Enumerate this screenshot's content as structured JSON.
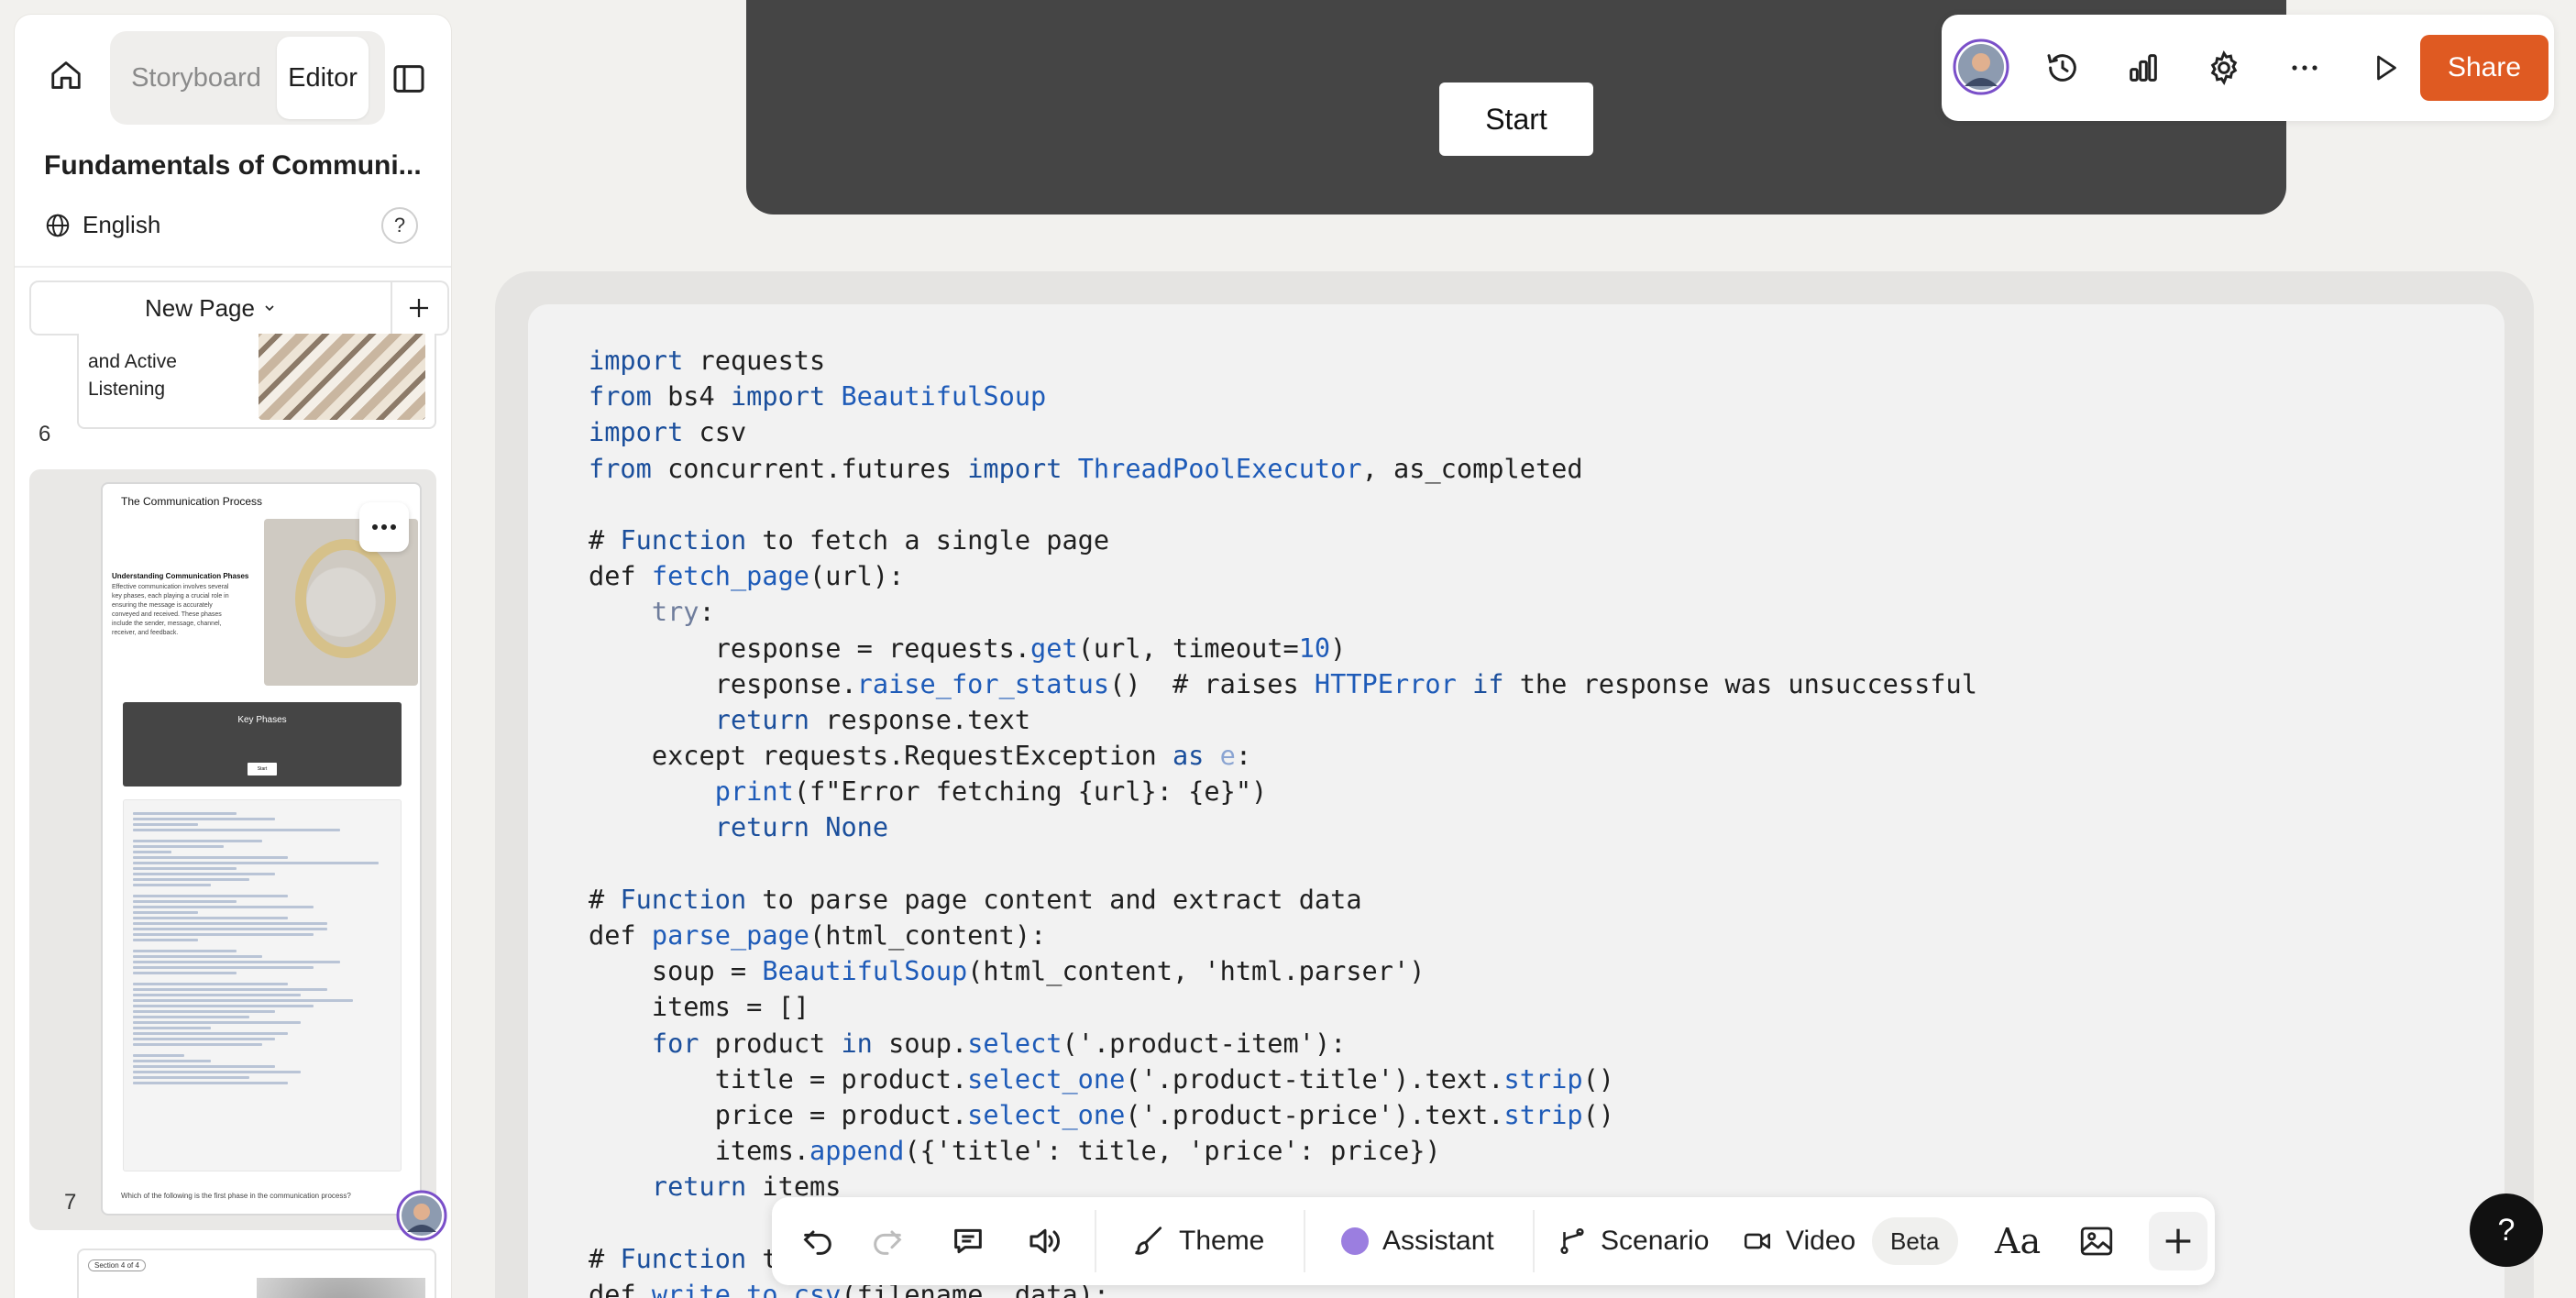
{
  "sidebar": {
    "tabs": {
      "storyboard": "Storyboard",
      "editor": "Editor"
    },
    "course_title": "Fundamentals of Communi...",
    "language": "English",
    "help": "?",
    "new_page": "New Page",
    "pages": [
      {
        "number": "6",
        "title": "and Active\nListening"
      },
      {
        "number": "7",
        "title": "The Communication Process",
        "subtitle": "Understanding Communication Phases",
        "body": "Effective communication involves several key phases, each playing a crucial role in ensuring the message is accurately conveyed and received. These phases include the sender, message, channel, receiver, and feedback.",
        "block_title": "Key Phases",
        "block_button": "Start",
        "question": "Which of the following is the first phase in the communication process?"
      },
      {
        "badge": "Section 4 of 4"
      }
    ]
  },
  "hero": {
    "button": "Start"
  },
  "code_lines": [
    [
      [
        "kw",
        "import"
      ],
      [
        "t",
        " requests"
      ]
    ],
    [
      [
        "kw",
        "from"
      ],
      [
        "t",
        " bs4 "
      ],
      [
        "kw",
        "import"
      ],
      [
        "fn",
        " BeautifulSoup"
      ]
    ],
    [
      [
        "kw",
        "import"
      ],
      [
        "t",
        " csv"
      ]
    ],
    [
      [
        "kw",
        "from"
      ],
      [
        "t",
        " concurrent.futures "
      ],
      [
        "kw",
        "import"
      ],
      [
        "fn",
        " ThreadPoolExecutor"
      ],
      [
        "t",
        ", as_completed"
      ]
    ],
    [],
    [
      [
        "t",
        "# "
      ],
      [
        "kw",
        "Function"
      ],
      [
        "t",
        " to fetch a single page"
      ]
    ],
    [
      [
        "t",
        "def "
      ],
      [
        "fn",
        "fetch_page"
      ],
      [
        "t",
        "(url):"
      ]
    ],
    [
      [
        "t",
        "    "
      ],
      [
        "try",
        "try"
      ],
      [
        "t",
        ":"
      ]
    ],
    [
      [
        "t",
        "        response = requests."
      ],
      [
        "fn",
        "get"
      ],
      [
        "t",
        "(url, timeout="
      ],
      [
        "num",
        "10"
      ],
      [
        "t",
        ")"
      ]
    ],
    [
      [
        "t",
        "        response."
      ],
      [
        "fn",
        "raise_for_status"
      ],
      [
        "t",
        "()  # raises "
      ],
      [
        "fn",
        "HTTPError"
      ],
      [
        "t",
        " "
      ],
      [
        "kw",
        "if"
      ],
      [
        "t",
        " the response was unsuccessful"
      ]
    ],
    [
      [
        "t",
        "        "
      ],
      [
        "kw",
        "return"
      ],
      [
        "t",
        " response.text"
      ]
    ],
    [
      [
        "t",
        "    except requests.RequestException "
      ],
      [
        "kw",
        "as"
      ],
      [
        "t",
        " "
      ],
      [
        "ev",
        "e"
      ],
      [
        "t",
        ":"
      ]
    ],
    [
      [
        "t",
        "        "
      ],
      [
        "fn",
        "print"
      ],
      [
        "t",
        "(f\"Error fetching {url}: {e}\")"
      ]
    ],
    [
      [
        "t",
        "        "
      ],
      [
        "kw",
        "return"
      ],
      [
        "t",
        " "
      ],
      [
        "kw",
        "None"
      ]
    ],
    [],
    [
      [
        "t",
        "# "
      ],
      [
        "kw",
        "Function"
      ],
      [
        "t",
        " to parse page content and extract data"
      ]
    ],
    [
      [
        "t",
        "def "
      ],
      [
        "fn",
        "parse_page"
      ],
      [
        "t",
        "(html_content):"
      ]
    ],
    [
      [
        "t",
        "    soup = "
      ],
      [
        "fn",
        "BeautifulSoup"
      ],
      [
        "t",
        "(html_content, 'html.parser')"
      ]
    ],
    [
      [
        "t",
        "    items = []"
      ]
    ],
    [
      [
        "t",
        "    "
      ],
      [
        "kw",
        "for"
      ],
      [
        "t",
        " product "
      ],
      [
        "kw",
        "in"
      ],
      [
        "t",
        " soup."
      ],
      [
        "fn",
        "select"
      ],
      [
        "t",
        "('.product-item'):"
      ]
    ],
    [
      [
        "t",
        "        title = product."
      ],
      [
        "fn",
        "select_one"
      ],
      [
        "t",
        "('.product-title').text."
      ],
      [
        "fn",
        "strip"
      ],
      [
        "t",
        "()"
      ]
    ],
    [
      [
        "t",
        "        price = product."
      ],
      [
        "fn",
        "select_one"
      ],
      [
        "t",
        "('.product-price').text."
      ],
      [
        "fn",
        "strip"
      ],
      [
        "t",
        "()"
      ]
    ],
    [
      [
        "t",
        "        items."
      ],
      [
        "fn",
        "append"
      ],
      [
        "t",
        "({'title': title, 'price': price})"
      ]
    ],
    [
      [
        "t",
        "    "
      ],
      [
        "kw",
        "return"
      ],
      [
        "t",
        " items"
      ]
    ],
    [],
    [
      [
        "t",
        "# "
      ],
      [
        "kw",
        "Function"
      ],
      [
        "t",
        " to write data to CSV"
      ]
    ],
    [
      [
        "t",
        "def "
      ],
      [
        "fn",
        "write_to_csv"
      ],
      [
        "t",
        "(filename, data):"
      ]
    ]
  ],
  "topbar": {
    "share": "Share"
  },
  "bottombar": {
    "theme": "Theme",
    "assistant": "Assistant",
    "scenario": "Scenario",
    "video": "Video",
    "beta": "Beta",
    "text_style": "Aa"
  },
  "help_fab": "?",
  "colors": {
    "accent": "#df5a22",
    "assistant_dot": "#9b7ee0",
    "avatar_ring": "#7a4fc9"
  }
}
